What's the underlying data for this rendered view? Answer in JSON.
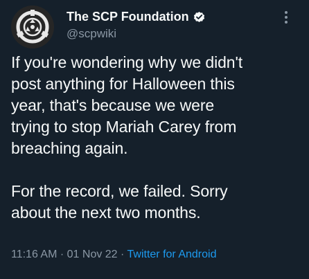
{
  "author": {
    "display_name": "The SCP Foundation",
    "handle": "@scpwiki",
    "verified": true,
    "avatar_icon": "scp-logo-icon"
  },
  "tweet": {
    "lines": [
      "If you're wondering why we didn't",
      "post anything for Halloween this",
      "year, that's because we were",
      "trying to stop Mariah Carey from",
      "breaching again.",
      "For the record, we failed. Sorry",
      "about the next two months."
    ]
  },
  "meta": {
    "time": "11:16 AM",
    "separator": " · ",
    "date": "01 Nov 22",
    "source": "Twitter for Android"
  },
  "colors": {
    "background": "#15202b",
    "text": "#f7f9f9",
    "secondary_text": "#8b98a5",
    "accent": "#1d9bf0"
  }
}
